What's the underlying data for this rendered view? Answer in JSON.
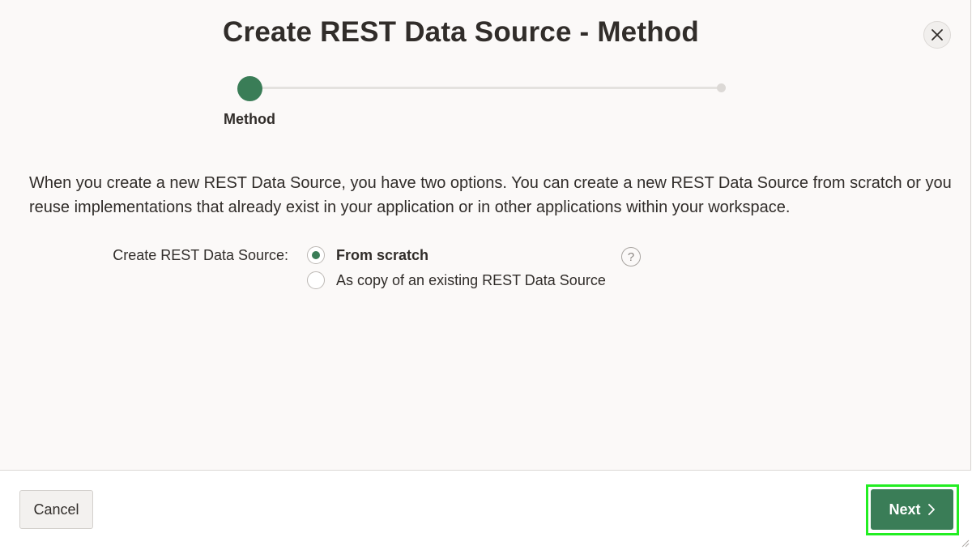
{
  "dialog": {
    "title": "Create REST Data Source - Method",
    "close_icon": "close-icon"
  },
  "progress": {
    "steps": [
      {
        "label": "Method",
        "state": "current"
      },
      {
        "label": "",
        "state": "upcoming"
      }
    ],
    "current_step": 1,
    "total_steps": 2
  },
  "intro_text": "When you create a new REST Data Source, you have two options. You can create a new REST Data Source from scratch or you reuse implementations that already exist in your application or in other applications within your workspace.",
  "form": {
    "field_label": "Create REST Data Source:",
    "options": [
      {
        "label": "From scratch",
        "selected": true
      },
      {
        "label": "As copy of an existing REST Data Source",
        "selected": false
      }
    ],
    "help_icon": "help-icon",
    "help_glyph": "?"
  },
  "footer": {
    "cancel_label": "Cancel",
    "next_label": "Next",
    "next_icon": "chevron-right-icon"
  },
  "colors": {
    "accent": "#3a7d57",
    "highlight": "#22ee22",
    "background": "#fbf9f8"
  }
}
